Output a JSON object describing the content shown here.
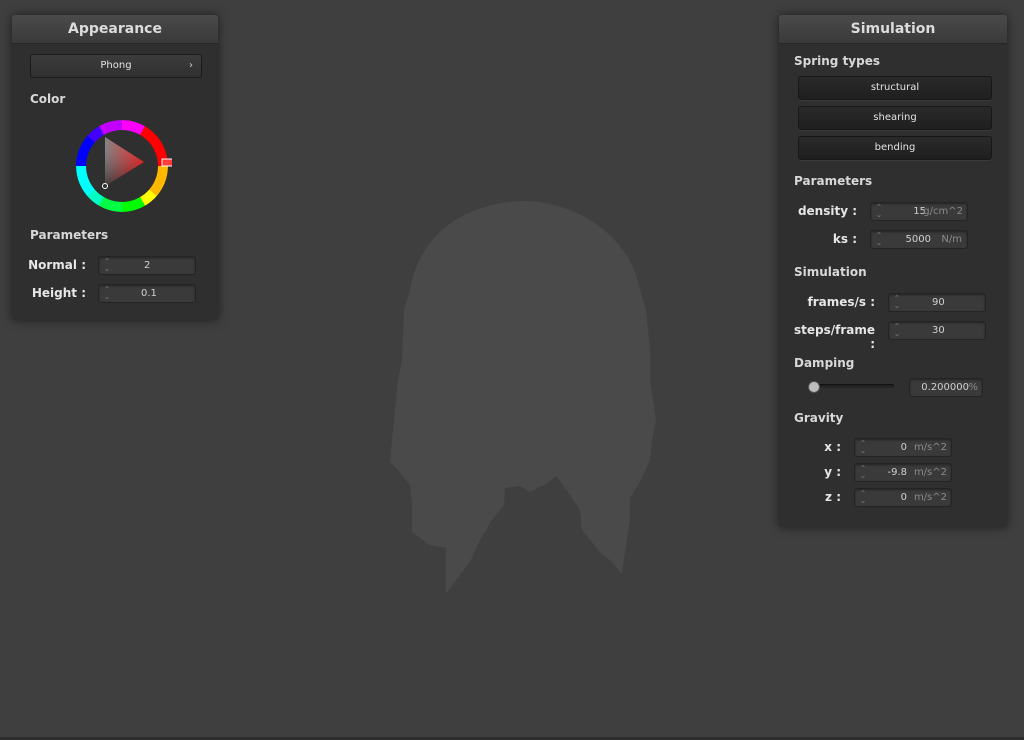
{
  "colors": {
    "background": "#3f3f3f",
    "panel": "#2f2f2f",
    "silhouette": "#4a4a4a",
    "color_accent": "#ff0000"
  },
  "appearance": {
    "title": "Appearance",
    "shader_select": "Phong",
    "color_label": "Color",
    "params_label": "Parameters",
    "normal": {
      "label": "Normal :",
      "value": "2"
    },
    "height": {
      "label": "Height :",
      "value": "0.1"
    }
  },
  "simulation": {
    "title": "Simulation",
    "spring_types_label": "Spring types",
    "spring_buttons": [
      "structural",
      "shearing",
      "bending"
    ],
    "params_label": "Parameters",
    "density": {
      "label": "density :",
      "value": "15",
      "unit": "g/cm^2"
    },
    "ks": {
      "label": "ks :",
      "value": "5000",
      "unit": "N/m"
    },
    "sim_label": "Simulation",
    "fps": {
      "label": "frames/s :",
      "value": "90"
    },
    "steps": {
      "label": "steps/frame :",
      "value": "30"
    },
    "damping_label": "Damping",
    "damping": {
      "value": "0.200000",
      "unit": "%",
      "slider_fraction": 0.2
    },
    "gravity_label": "Gravity",
    "gx": {
      "label": "x :",
      "value": "0",
      "unit": "m/s^2"
    },
    "gy": {
      "label": "y :",
      "value": "-9.8",
      "unit": "m/s^2"
    },
    "gz": {
      "label": "z :",
      "value": "0",
      "unit": "m/s^2"
    }
  }
}
